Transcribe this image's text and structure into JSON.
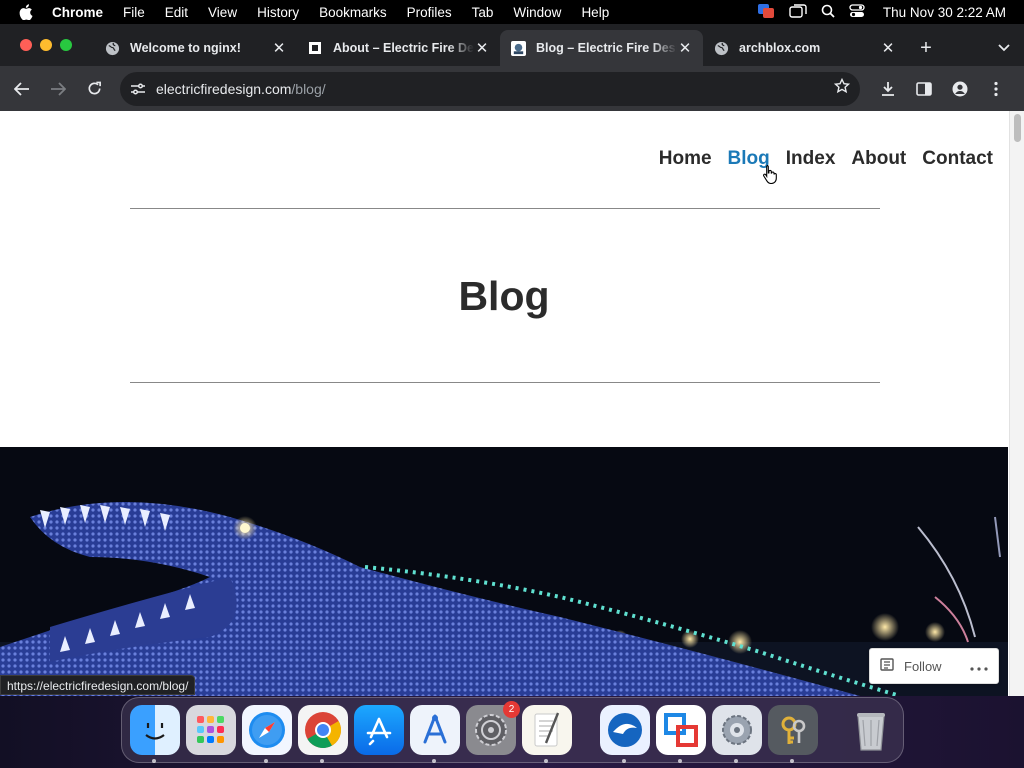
{
  "menubar": {
    "app": "Chrome",
    "items": [
      "File",
      "Edit",
      "View",
      "History",
      "Bookmarks",
      "Profiles",
      "Tab",
      "Window",
      "Help"
    ],
    "clock": "Thu Nov 30  2:22 AM"
  },
  "tabs": [
    {
      "title": "Welcome to nginx!",
      "favicon": "globe-icon",
      "active": false
    },
    {
      "title": "About – Electric Fire Design",
      "favicon": "square-icon",
      "active": false
    },
    {
      "title": "Blog – Electric Fire Design",
      "favicon": "site-icon",
      "active": true
    },
    {
      "title": "archblox.com",
      "favicon": "globe-icon",
      "active": false
    }
  ],
  "toolbar": {
    "url_domain": "electricfiredesign.com",
    "url_path": "/blog/"
  },
  "page": {
    "nav": [
      "Home",
      "Blog",
      "Index",
      "About",
      "Contact"
    ],
    "active_nav": "Blog",
    "title": "Blog",
    "follow_label": "Follow",
    "status_url": "https://electricfiredesign.com/blog/"
  },
  "dock": {
    "apps": [
      "Finder",
      "Launchpad",
      "Safari",
      "Chrome",
      "App Store",
      "Instruments",
      "System Settings",
      "TextEdit",
      "Proxyman",
      "Parallels",
      "Network Preferences",
      "Keychain Access",
      "Trash"
    ],
    "settings_badge": "2"
  },
  "colors": {
    "nav_active": "#1b79b7",
    "text": "#2b2b2b",
    "chrome_bg": "#202124",
    "chrome_active": "#35363a"
  }
}
